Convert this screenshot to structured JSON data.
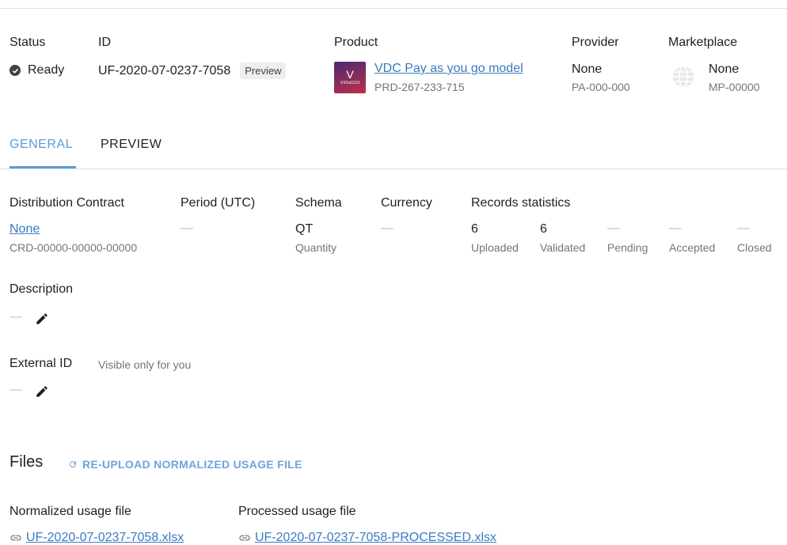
{
  "summary": {
    "status": {
      "label": "Status",
      "value": "Ready"
    },
    "id": {
      "label": "ID",
      "value": "UF-2020-07-0237-7058",
      "badge": "Preview"
    },
    "product": {
      "label": "Product",
      "name": "VDC Pay as you go model",
      "code": "PRD-267-233-715",
      "logo_text": "V",
      "logo_caption": "Virtuozzo"
    },
    "provider": {
      "label": "Provider",
      "name": "None",
      "code": "PA-000-000"
    },
    "marketplace": {
      "label": "Marketplace",
      "name": "None",
      "code": "MP-00000"
    }
  },
  "tabs": [
    {
      "label": "GENERAL",
      "active": true
    },
    {
      "label": "PREVIEW",
      "active": false
    }
  ],
  "general": {
    "contract": {
      "label": "Distribution Contract",
      "value": "None",
      "code": "CRD-00000-00000-00000"
    },
    "period": {
      "label": "Period (UTC)",
      "value": "—"
    },
    "schema": {
      "label": "Schema",
      "value": "QT",
      "sub": "Quantity"
    },
    "currency": {
      "label": "Currency",
      "value": "—"
    },
    "records": {
      "label": "Records statistics",
      "items": [
        {
          "value": "6",
          "label": "Uploaded"
        },
        {
          "value": "6",
          "label": "Validated"
        },
        {
          "value": "—",
          "label": "Pending"
        },
        {
          "value": "—",
          "label": "Accepted"
        },
        {
          "value": "—",
          "label": "Closed"
        }
      ]
    },
    "description": {
      "label": "Description",
      "value": "—"
    },
    "external_id": {
      "label": "External ID",
      "hint": "Visible only for you",
      "value": "—"
    }
  },
  "files": {
    "title": "Files",
    "reupload_label": "RE-UPLOAD NORMALIZED USAGE FILE",
    "normalized": {
      "label": "Normalized usage file",
      "filename": "UF-2020-07-0237-7058.xlsx"
    },
    "processed": {
      "label": "Processed usage file",
      "filename": "UF-2020-07-0237-7058-PROCESSED.xlsx"
    }
  },
  "colors": {
    "accent": "#5c9bd6",
    "link": "#3a7bbf",
    "muted": "#757575"
  }
}
